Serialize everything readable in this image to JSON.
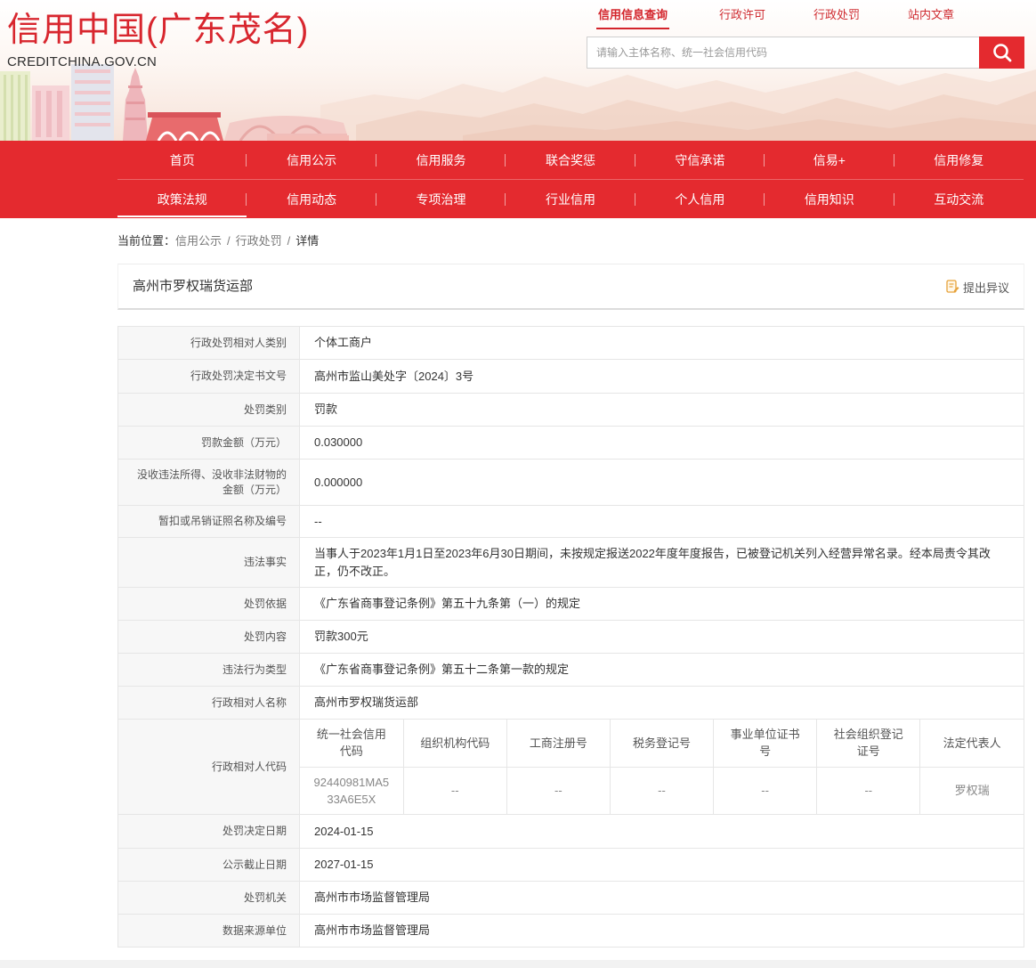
{
  "theme": {
    "primary": "#e42a2f"
  },
  "logo": {
    "title": "信用中国(广东茂名)",
    "domain": "CREDITCHINA.GOV.CN"
  },
  "top_nav": [
    {
      "label": "信用信息查询",
      "active": true
    },
    {
      "label": "行政许可"
    },
    {
      "label": "行政处罚"
    },
    {
      "label": "站内文章"
    }
  ],
  "search": {
    "placeholder": "请输入主体名称、统一社会信用代码",
    "button_icon": "search-icon"
  },
  "main_nav": {
    "row1": [
      "首页",
      "信用公示",
      "信用服务",
      "联合奖惩",
      "守信承诺",
      "信易+",
      "信用修复"
    ],
    "row2": [
      "政策法规",
      "信用动态",
      "专项治理",
      "行业信用",
      "个人信用",
      "信用知识",
      "互动交流"
    ]
  },
  "breadcrumb": {
    "prefix": "当前位置：",
    "separator": "/",
    "items": [
      "信用公示",
      "行政处罚",
      "详情"
    ]
  },
  "entity": {
    "name": "高州市罗权瑞货运部",
    "objection_label": "提出异议",
    "objection_icon": "edit-document-icon"
  },
  "details": [
    {
      "label": "行政处罚相对人类别",
      "value": "个体工商户"
    },
    {
      "label": "行政处罚决定书文号",
      "value": "高州市监山美处字〔2024〕3号"
    },
    {
      "label": "处罚类别",
      "value": "罚款"
    },
    {
      "label": "罚款金额（万元）",
      "value": "0.030000"
    },
    {
      "label": "没收违法所得、没收非法财物的金额（万元）",
      "value": "0.000000"
    },
    {
      "label": "暂扣或吊销证照名称及编号",
      "value": "--"
    },
    {
      "label": "违法事实",
      "value": "当事人于2023年1月1日至2023年6月30日期间，未按规定报送2022年度年度报告，已被登记机关列入经营异常名录。经本局责令其改正，仍不改正。"
    },
    {
      "label": "处罚依据",
      "value": "《广东省商事登记条例》第五十九条第（一）的规定"
    },
    {
      "label": "处罚内容",
      "value": "罚款300元"
    },
    {
      "label": "违法行为类型",
      "value": "《广东省商事登记条例》第五十二条第一款的规定"
    },
    {
      "label": "行政相对人名称",
      "value": "高州市罗权瑞货运部"
    },
    {
      "label": "行政相对人代码"
    },
    {
      "label": "处罚决定日期",
      "value": "2024-01-15"
    },
    {
      "label": "公示截止日期",
      "value": "2027-01-15"
    },
    {
      "label": "处罚机关",
      "value": "高州市市场监督管理局"
    },
    {
      "label": "数据来源单位",
      "value": "高州市市场监督管理局"
    }
  ],
  "code_table": {
    "headers": [
      "统一社会信用代码",
      "组织机构代码",
      "工商注册号",
      "税务登记号",
      "事业单位证书号",
      "社会组织登记证号",
      "法定代表人"
    ],
    "values": [
      "92440981MA533A6E5X",
      "--",
      "--",
      "--",
      "--",
      "--",
      "罗权瑞"
    ]
  }
}
